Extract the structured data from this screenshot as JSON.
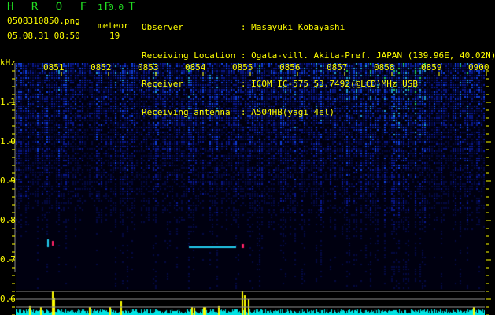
{
  "header": {
    "app_title": "H R O F F T",
    "version": "1.0.0",
    "filename": "0508310850.png",
    "datetime": "05.08.31 08:50",
    "meteor_label": "meteor",
    "meteor_count": "19"
  },
  "info": [
    {
      "label": "Observer           ",
      "value": ": Masayuki Kobayashi"
    },
    {
      "label": "Receiving Location ",
      "value": ": Ogata-vill. Akita-Pref. JAPAN (139.96E, 40.02N)"
    },
    {
      "label": "Receiver           ",
      "value": ": ICOM IC-575 53.7492(@LCD)MHz USB"
    },
    {
      "label": "Receiving antenna  ",
      "value": ": A504HB(yagi 4el)"
    }
  ],
  "spectrogram": {
    "y_unit": "kHz",
    "y_ticks": [
      "1.1",
      "1.0",
      "0.9",
      "0.8",
      "0.7",
      "0.6"
    ],
    "time_labels": [
      "0851",
      "0852",
      "0853",
      "0854",
      "0855",
      "0856",
      "0857",
      "0858",
      "0859",
      "0900"
    ],
    "colors": {
      "text": "#ffff00",
      "title": "#22dd22",
      "level": "#00e5e5",
      "meteor_bar": "#ffff00",
      "grid": "#888888"
    }
  }
}
